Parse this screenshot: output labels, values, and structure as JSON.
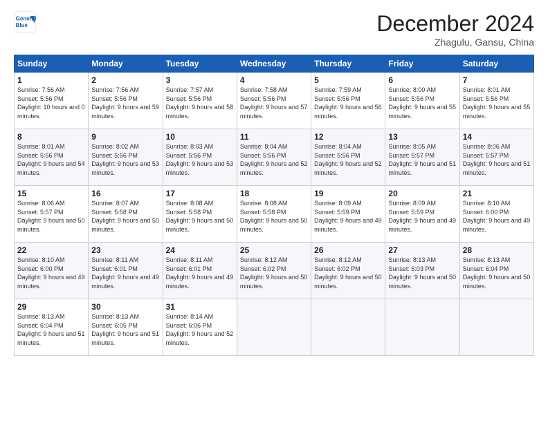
{
  "logo": {
    "line1": "General",
    "line2": "Blue"
  },
  "title": "December 2024",
  "location": "Zhagulu, Gansu, China",
  "days_header": [
    "Sunday",
    "Monday",
    "Tuesday",
    "Wednesday",
    "Thursday",
    "Friday",
    "Saturday"
  ],
  "weeks": [
    [
      {
        "day": 1,
        "sunrise": "7:56 AM",
        "sunset": "5:56 PM",
        "daylight": "10 hours and 0 minutes"
      },
      {
        "day": 2,
        "sunrise": "7:56 AM",
        "sunset": "5:56 PM",
        "daylight": "9 hours and 59 minutes"
      },
      {
        "day": 3,
        "sunrise": "7:57 AM",
        "sunset": "5:56 PM",
        "daylight": "9 hours and 58 minutes"
      },
      {
        "day": 4,
        "sunrise": "7:58 AM",
        "sunset": "5:56 PM",
        "daylight": "9 hours and 57 minutes"
      },
      {
        "day": 5,
        "sunrise": "7:59 AM",
        "sunset": "5:56 PM",
        "daylight": "9 hours and 56 minutes"
      },
      {
        "day": 6,
        "sunrise": "8:00 AM",
        "sunset": "5:56 PM",
        "daylight": "9 hours and 55 minutes"
      },
      {
        "day": 7,
        "sunrise": "8:01 AM",
        "sunset": "5:56 PM",
        "daylight": "9 hours and 55 minutes"
      }
    ],
    [
      {
        "day": 8,
        "sunrise": "8:01 AM",
        "sunset": "5:56 PM",
        "daylight": "9 hours and 54 minutes"
      },
      {
        "day": 9,
        "sunrise": "8:02 AM",
        "sunset": "5:56 PM",
        "daylight": "9 hours and 53 minutes"
      },
      {
        "day": 10,
        "sunrise": "8:03 AM",
        "sunset": "5:56 PM",
        "daylight": "9 hours and 53 minutes"
      },
      {
        "day": 11,
        "sunrise": "8:04 AM",
        "sunset": "5:56 PM",
        "daylight": "9 hours and 52 minutes"
      },
      {
        "day": 12,
        "sunrise": "8:04 AM",
        "sunset": "5:56 PM",
        "daylight": "9 hours and 52 minutes"
      },
      {
        "day": 13,
        "sunrise": "8:05 AM",
        "sunset": "5:57 PM",
        "daylight": "9 hours and 51 minutes"
      },
      {
        "day": 14,
        "sunrise": "8:06 AM",
        "sunset": "5:57 PM",
        "daylight": "9 hours and 51 minutes"
      }
    ],
    [
      {
        "day": 15,
        "sunrise": "8:06 AM",
        "sunset": "5:57 PM",
        "daylight": "9 hours and 50 minutes"
      },
      {
        "day": 16,
        "sunrise": "8:07 AM",
        "sunset": "5:58 PM",
        "daylight": "9 hours and 50 minutes"
      },
      {
        "day": 17,
        "sunrise": "8:08 AM",
        "sunset": "5:58 PM",
        "daylight": "9 hours and 50 minutes"
      },
      {
        "day": 18,
        "sunrise": "8:08 AM",
        "sunset": "5:58 PM",
        "daylight": "9 hours and 50 minutes"
      },
      {
        "day": 19,
        "sunrise": "8:09 AM",
        "sunset": "5:59 PM",
        "daylight": "9 hours and 49 minutes"
      },
      {
        "day": 20,
        "sunrise": "8:09 AM",
        "sunset": "5:59 PM",
        "daylight": "9 hours and 49 minutes"
      },
      {
        "day": 21,
        "sunrise": "8:10 AM",
        "sunset": "6:00 PM",
        "daylight": "9 hours and 49 minutes"
      }
    ],
    [
      {
        "day": 22,
        "sunrise": "8:10 AM",
        "sunset": "6:00 PM",
        "daylight": "9 hours and 49 minutes"
      },
      {
        "day": 23,
        "sunrise": "8:11 AM",
        "sunset": "6:01 PM",
        "daylight": "9 hours and 49 minutes"
      },
      {
        "day": 24,
        "sunrise": "8:11 AM",
        "sunset": "6:01 PM",
        "daylight": "9 hours and 49 minutes"
      },
      {
        "day": 25,
        "sunrise": "8:12 AM",
        "sunset": "6:02 PM",
        "daylight": "9 hours and 50 minutes"
      },
      {
        "day": 26,
        "sunrise": "8:12 AM",
        "sunset": "6:02 PM",
        "daylight": "9 hours and 50 minutes"
      },
      {
        "day": 27,
        "sunrise": "8:13 AM",
        "sunset": "6:03 PM",
        "daylight": "9 hours and 50 minutes"
      },
      {
        "day": 28,
        "sunrise": "8:13 AM",
        "sunset": "6:04 PM",
        "daylight": "9 hours and 50 minutes"
      }
    ],
    [
      {
        "day": 29,
        "sunrise": "8:13 AM",
        "sunset": "6:04 PM",
        "daylight": "9 hours and 51 minutes"
      },
      {
        "day": 30,
        "sunrise": "8:13 AM",
        "sunset": "6:05 PM",
        "daylight": "9 hours and 51 minutes"
      },
      {
        "day": 31,
        "sunrise": "8:14 AM",
        "sunset": "6:06 PM",
        "daylight": "9 hours and 52 minutes"
      },
      null,
      null,
      null,
      null
    ]
  ]
}
